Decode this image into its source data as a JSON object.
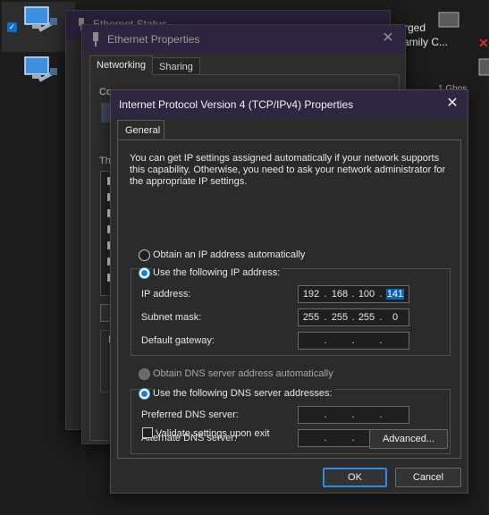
{
  "background": {
    "items": [
      {
        "text_line1": "rged",
        "text_line2": "amily C..."
      },
      {
        "text": "1 Gbps"
      }
    ]
  },
  "status_dialog": {
    "title": "Ethernet Status"
  },
  "properties_dialog": {
    "title": "Ethernet Properties",
    "tabs": [
      "Networking",
      "Sharing"
    ],
    "connect_using_partial": "Conn",
    "this_connection_partial": "Th",
    "description_partial": "D"
  },
  "ipv4_dialog": {
    "title": "Internet Protocol Version 4 (TCP/IPv4) Properties",
    "tab": "General",
    "description": "You can get IP settings assigned automatically if your network supports this capability. Otherwise, you need to ask your network administrator for the appropriate IP settings.",
    "ip_mode": {
      "auto_label": "Obtain an IP address automatically",
      "manual_label": "Use the following IP address:",
      "selected": "manual"
    },
    "ip_fields": [
      {
        "label": "IP address:",
        "octets": [
          "192",
          "168",
          "100",
          "141"
        ],
        "selected_octet": 3
      },
      {
        "label": "Subnet mask:",
        "octets": [
          "255",
          "255",
          "255",
          "0"
        ]
      },
      {
        "label": "Default gateway:",
        "octets": [
          "",
          "",
          "",
          ""
        ]
      }
    ],
    "dns_mode": {
      "auto_label": "Obtain DNS server address automatically",
      "manual_label": "Use the following DNS server addresses:",
      "selected": "manual"
    },
    "dns_fields": [
      {
        "label": "Preferred DNS server:",
        "octets": [
          "",
          "",
          "",
          ""
        ]
      },
      {
        "label": "Alternate DNS server:",
        "octets": [
          "",
          "",
          "",
          ""
        ]
      }
    ],
    "validate_label": "Validate settings upon exit",
    "validate_checked": false,
    "advanced_label": "Advanced...",
    "ok_label": "OK",
    "cancel_label": "Cancel"
  },
  "colors": {
    "accent": "#1b7fe0",
    "selection": "#0a64c2",
    "error": "#d82b2b"
  },
  "icons": [
    "network-adapter-icon",
    "checkbox-checked-icon",
    "close-icon",
    "error-x-icon"
  ]
}
